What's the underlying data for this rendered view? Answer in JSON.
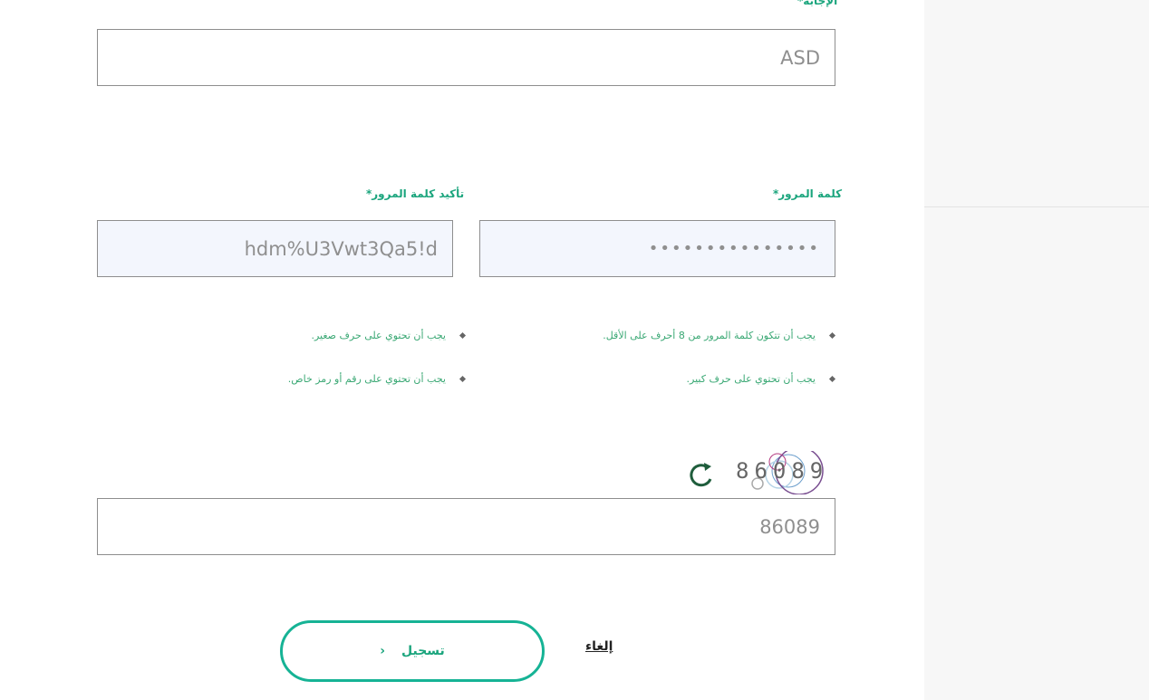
{
  "form": {
    "answer": {
      "label": "الإجابة*",
      "value": "ASD"
    },
    "password": {
      "label": "كلمة المرور*",
      "value": "•••••••••••••••"
    },
    "confirm_password": {
      "label": "تأكيد كلمة المرور*",
      "value": "hdm%U3Vwt3Qa5!d"
    },
    "rules": [
      "يجب أن تتكون كلمة المرور من 8 أحرف على الأقل.",
      "يجب أن تحتوي على حرف صغير.",
      "يجب أن تحتوي على حرف كبير.",
      "يجب أن تحتوي على رقم أو رمز خاص."
    ],
    "captcha": {
      "image_text": "86089",
      "value": "86089"
    },
    "submit_label": "تسجيل",
    "cancel_label": "إلغاء"
  },
  "colors": {
    "accent": "#1ba57d",
    "button_border": "#16b395"
  }
}
